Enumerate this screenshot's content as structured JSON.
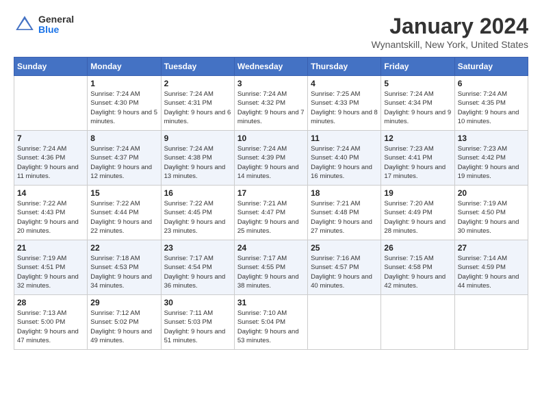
{
  "header": {
    "logo": {
      "general": "General",
      "blue": "Blue"
    },
    "title": "January 2024",
    "location": "Wynantskill, New York, United States"
  },
  "weekdays": [
    "Sunday",
    "Monday",
    "Tuesday",
    "Wednesday",
    "Thursday",
    "Friday",
    "Saturday"
  ],
  "weeks": [
    [
      {
        "day": "",
        "sunrise": "",
        "sunset": "",
        "daylight": ""
      },
      {
        "day": "1",
        "sunrise": "Sunrise: 7:24 AM",
        "sunset": "Sunset: 4:30 PM",
        "daylight": "Daylight: 9 hours and 5 minutes."
      },
      {
        "day": "2",
        "sunrise": "Sunrise: 7:24 AM",
        "sunset": "Sunset: 4:31 PM",
        "daylight": "Daylight: 9 hours and 6 minutes."
      },
      {
        "day": "3",
        "sunrise": "Sunrise: 7:24 AM",
        "sunset": "Sunset: 4:32 PM",
        "daylight": "Daylight: 9 hours and 7 minutes."
      },
      {
        "day": "4",
        "sunrise": "Sunrise: 7:25 AM",
        "sunset": "Sunset: 4:33 PM",
        "daylight": "Daylight: 9 hours and 8 minutes."
      },
      {
        "day": "5",
        "sunrise": "Sunrise: 7:24 AM",
        "sunset": "Sunset: 4:34 PM",
        "daylight": "Daylight: 9 hours and 9 minutes."
      },
      {
        "day": "6",
        "sunrise": "Sunrise: 7:24 AM",
        "sunset": "Sunset: 4:35 PM",
        "daylight": "Daylight: 9 hours and 10 minutes."
      }
    ],
    [
      {
        "day": "7",
        "sunrise": "Sunrise: 7:24 AM",
        "sunset": "Sunset: 4:36 PM",
        "daylight": "Daylight: 9 hours and 11 minutes."
      },
      {
        "day": "8",
        "sunrise": "Sunrise: 7:24 AM",
        "sunset": "Sunset: 4:37 PM",
        "daylight": "Daylight: 9 hours and 12 minutes."
      },
      {
        "day": "9",
        "sunrise": "Sunrise: 7:24 AM",
        "sunset": "Sunset: 4:38 PM",
        "daylight": "Daylight: 9 hours and 13 minutes."
      },
      {
        "day": "10",
        "sunrise": "Sunrise: 7:24 AM",
        "sunset": "Sunset: 4:39 PM",
        "daylight": "Daylight: 9 hours and 14 minutes."
      },
      {
        "day": "11",
        "sunrise": "Sunrise: 7:24 AM",
        "sunset": "Sunset: 4:40 PM",
        "daylight": "Daylight: 9 hours and 16 minutes."
      },
      {
        "day": "12",
        "sunrise": "Sunrise: 7:23 AM",
        "sunset": "Sunset: 4:41 PM",
        "daylight": "Daylight: 9 hours and 17 minutes."
      },
      {
        "day": "13",
        "sunrise": "Sunrise: 7:23 AM",
        "sunset": "Sunset: 4:42 PM",
        "daylight": "Daylight: 9 hours and 19 minutes."
      }
    ],
    [
      {
        "day": "14",
        "sunrise": "Sunrise: 7:22 AM",
        "sunset": "Sunset: 4:43 PM",
        "daylight": "Daylight: 9 hours and 20 minutes."
      },
      {
        "day": "15",
        "sunrise": "Sunrise: 7:22 AM",
        "sunset": "Sunset: 4:44 PM",
        "daylight": "Daylight: 9 hours and 22 minutes."
      },
      {
        "day": "16",
        "sunrise": "Sunrise: 7:22 AM",
        "sunset": "Sunset: 4:45 PM",
        "daylight": "Daylight: 9 hours and 23 minutes."
      },
      {
        "day": "17",
        "sunrise": "Sunrise: 7:21 AM",
        "sunset": "Sunset: 4:47 PM",
        "daylight": "Daylight: 9 hours and 25 minutes."
      },
      {
        "day": "18",
        "sunrise": "Sunrise: 7:21 AM",
        "sunset": "Sunset: 4:48 PM",
        "daylight": "Daylight: 9 hours and 27 minutes."
      },
      {
        "day": "19",
        "sunrise": "Sunrise: 7:20 AM",
        "sunset": "Sunset: 4:49 PM",
        "daylight": "Daylight: 9 hours and 28 minutes."
      },
      {
        "day": "20",
        "sunrise": "Sunrise: 7:19 AM",
        "sunset": "Sunset: 4:50 PM",
        "daylight": "Daylight: 9 hours and 30 minutes."
      }
    ],
    [
      {
        "day": "21",
        "sunrise": "Sunrise: 7:19 AM",
        "sunset": "Sunset: 4:51 PM",
        "daylight": "Daylight: 9 hours and 32 minutes."
      },
      {
        "day": "22",
        "sunrise": "Sunrise: 7:18 AM",
        "sunset": "Sunset: 4:53 PM",
        "daylight": "Daylight: 9 hours and 34 minutes."
      },
      {
        "day": "23",
        "sunrise": "Sunrise: 7:17 AM",
        "sunset": "Sunset: 4:54 PM",
        "daylight": "Daylight: 9 hours and 36 minutes."
      },
      {
        "day": "24",
        "sunrise": "Sunrise: 7:17 AM",
        "sunset": "Sunset: 4:55 PM",
        "daylight": "Daylight: 9 hours and 38 minutes."
      },
      {
        "day": "25",
        "sunrise": "Sunrise: 7:16 AM",
        "sunset": "Sunset: 4:57 PM",
        "daylight": "Daylight: 9 hours and 40 minutes."
      },
      {
        "day": "26",
        "sunrise": "Sunrise: 7:15 AM",
        "sunset": "Sunset: 4:58 PM",
        "daylight": "Daylight: 9 hours and 42 minutes."
      },
      {
        "day": "27",
        "sunrise": "Sunrise: 7:14 AM",
        "sunset": "Sunset: 4:59 PM",
        "daylight": "Daylight: 9 hours and 44 minutes."
      }
    ],
    [
      {
        "day": "28",
        "sunrise": "Sunrise: 7:13 AM",
        "sunset": "Sunset: 5:00 PM",
        "daylight": "Daylight: 9 hours and 47 minutes."
      },
      {
        "day": "29",
        "sunrise": "Sunrise: 7:12 AM",
        "sunset": "Sunset: 5:02 PM",
        "daylight": "Daylight: 9 hours and 49 minutes."
      },
      {
        "day": "30",
        "sunrise": "Sunrise: 7:11 AM",
        "sunset": "Sunset: 5:03 PM",
        "daylight": "Daylight: 9 hours and 51 minutes."
      },
      {
        "day": "31",
        "sunrise": "Sunrise: 7:10 AM",
        "sunset": "Sunset: 5:04 PM",
        "daylight": "Daylight: 9 hours and 53 minutes."
      },
      {
        "day": "",
        "sunrise": "",
        "sunset": "",
        "daylight": ""
      },
      {
        "day": "",
        "sunrise": "",
        "sunset": "",
        "daylight": ""
      },
      {
        "day": "",
        "sunrise": "",
        "sunset": "",
        "daylight": ""
      }
    ]
  ]
}
